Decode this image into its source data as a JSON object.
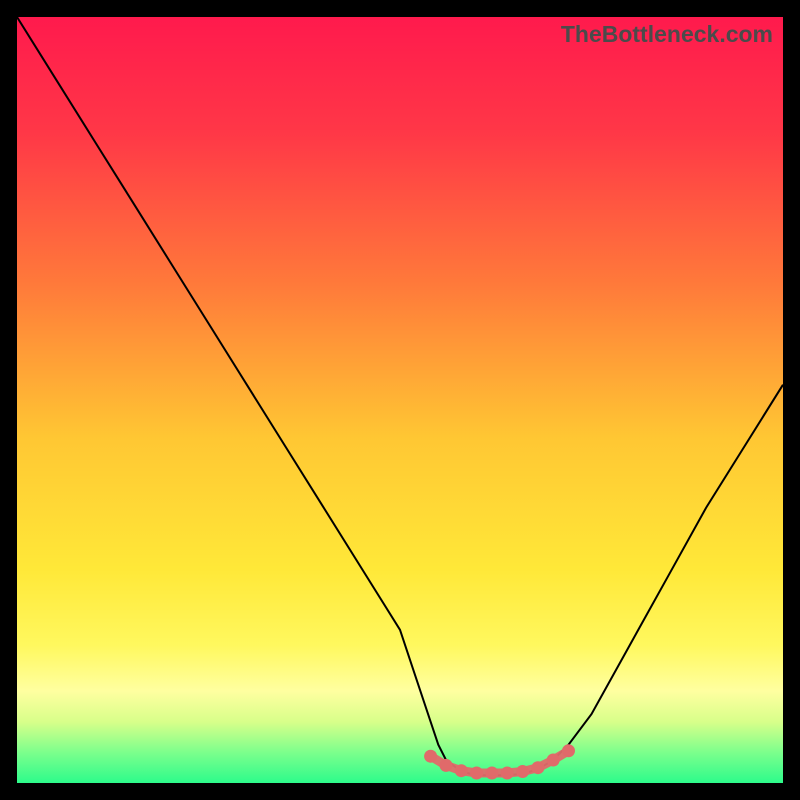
{
  "watermark": "TheBottleneck.com",
  "colors": {
    "gradient_stops": [
      {
        "offset": 0.0,
        "color": "#ff1a4d"
      },
      {
        "offset": 0.15,
        "color": "#ff3747"
      },
      {
        "offset": 0.35,
        "color": "#ff7a3a"
      },
      {
        "offset": 0.55,
        "color": "#ffc733"
      },
      {
        "offset": 0.72,
        "color": "#ffe838"
      },
      {
        "offset": 0.82,
        "color": "#fff85e"
      },
      {
        "offset": 0.88,
        "color": "#ffffa0"
      },
      {
        "offset": 0.92,
        "color": "#d8ff8a"
      },
      {
        "offset": 0.96,
        "color": "#7cff8c"
      },
      {
        "offset": 1.0,
        "color": "#2dfb8b"
      }
    ],
    "curve_stroke": "#000000",
    "marker_fill": "#e06a6a",
    "marker_stroke": "#e06a6a"
  },
  "chart_data": {
    "type": "line",
    "title": "",
    "xlabel": "",
    "ylabel": "",
    "xlim": [
      0,
      100
    ],
    "ylim": [
      0,
      100
    ],
    "grid": false,
    "series": [
      {
        "name": "bottleneck-curve",
        "x": [
          0,
          5,
          10,
          15,
          20,
          25,
          30,
          35,
          40,
          45,
          50,
          52,
          54,
          55,
          56,
          58,
          60,
          62,
          64,
          66,
          68,
          70,
          72,
          75,
          80,
          85,
          90,
          95,
          100
        ],
        "values": [
          100,
          92,
          84,
          76,
          68,
          60,
          52,
          44,
          36,
          28,
          20,
          14,
          8,
          5,
          3,
          1.5,
          1,
          1,
          1,
          1.2,
          1.8,
          3,
          5,
          9,
          18,
          27,
          36,
          44,
          52
        ]
      }
    ],
    "markers": {
      "name": "optimal-range",
      "x": [
        54,
        56,
        58,
        60,
        62,
        64,
        66,
        68,
        70,
        72
      ],
      "values": [
        3.5,
        2.3,
        1.6,
        1.3,
        1.3,
        1.3,
        1.5,
        2.0,
        3.0,
        4.2
      ]
    }
  }
}
